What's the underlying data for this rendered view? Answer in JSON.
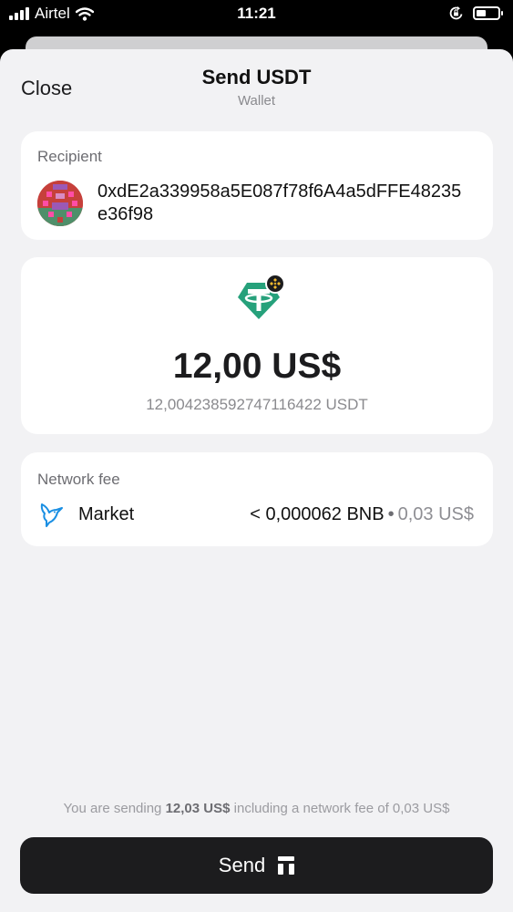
{
  "status_bar": {
    "carrier": "Airtel",
    "time": "11:21"
  },
  "header": {
    "close_label": "Close",
    "title": "Send USDT",
    "subtitle": "Wallet"
  },
  "recipient": {
    "label": "Recipient",
    "address": "0xdE2a339958a5E087f78f6A4a5dFFE48235e36f98"
  },
  "amount": {
    "fiat": "12,00 US$",
    "crypto": "12,004238592747116422 USDT",
    "token_icon": "tether-icon",
    "network_icon": "bnb-icon"
  },
  "network_fee": {
    "label": "Network fee",
    "speed": "Market",
    "amount": "< 0,000062 BNB",
    "separator": "•",
    "fiat": "0,03 US$",
    "icon": "hummingbird-icon"
  },
  "summary": {
    "prefix": "You are sending",
    "total": "12,03 US$",
    "suffix": "including a network fee of 0,03 US$"
  },
  "send_button": {
    "label": "Send",
    "icon": "trust-wallet-icon"
  },
  "colors": {
    "tether": "#26a17b",
    "bnb": "#f3ba2f",
    "button": "#1c1c1e",
    "background": "#f2f2f4"
  }
}
